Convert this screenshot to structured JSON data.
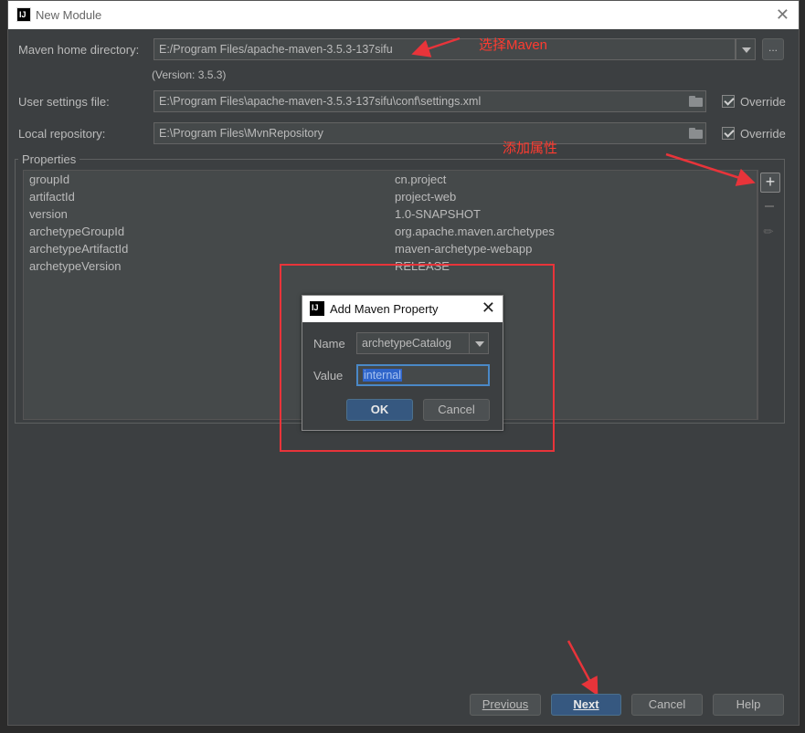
{
  "dialog": {
    "title": "New Module",
    "icon_text": "IJ"
  },
  "maven_home": {
    "label": "Maven home directory:",
    "value": "E:/Program Files/apache-maven-3.5.3-137sifu",
    "version": "(Version: 3.5.3)",
    "browse_label": "..."
  },
  "user_settings": {
    "label": "User settings file:",
    "value": "E:\\Program Files\\apache-maven-3.5.3-137sifu\\conf\\settings.xml",
    "override_label": "Override"
  },
  "local_repo": {
    "label": "Local repository:",
    "value": "E:\\Program Files\\MvnRepository",
    "override_label": "Override"
  },
  "properties": {
    "title": "Properties",
    "rows": [
      {
        "key": "groupId",
        "value": "cn.project"
      },
      {
        "key": "artifactId",
        "value": "project-web"
      },
      {
        "key": "version",
        "value": "1.0-SNAPSHOT"
      },
      {
        "key": "archetypeGroupId",
        "value": "org.apache.maven.archetypes"
      },
      {
        "key": "archetypeArtifactId",
        "value": "maven-archetype-webapp"
      },
      {
        "key": "archetypeVersion",
        "value": "RELEASE"
      }
    ]
  },
  "annotations": {
    "select_maven": "选择Maven",
    "add_property": "添加属性"
  },
  "add_property_dialog": {
    "title": "Add Maven Property",
    "name_label": "Name",
    "name_value": "archetypeCatalog",
    "value_label": "Value",
    "value_value": "internal",
    "ok_label": "OK",
    "cancel_label": "Cancel"
  },
  "footer": {
    "previous_label": "Previous",
    "next_label": "Next",
    "cancel_label": "Cancel",
    "help_label": "Help"
  },
  "colors": {
    "background": "#3c3f41",
    "accent": "#365880",
    "annotation": "#ff3b30"
  }
}
